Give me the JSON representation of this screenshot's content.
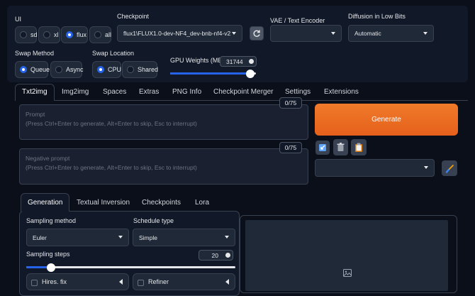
{
  "ui": {
    "label": "UI",
    "options": [
      "sd",
      "xl",
      "flux",
      "all"
    ],
    "selected": "flux"
  },
  "checkpoint": {
    "label": "Checkpoint",
    "value": "flux1\\FLUX1.0-dev-NF4_dev-bnb-nf4-v2.sa"
  },
  "vae": {
    "label": "VAE / Text Encoder",
    "value": ""
  },
  "diffusion": {
    "label": "Diffusion in Low Bits",
    "value": "Automatic"
  },
  "swap_method": {
    "label": "Swap Method",
    "options": [
      "Queue",
      "Async"
    ],
    "selected": "Queue"
  },
  "swap_location": {
    "label": "Swap Location",
    "options": [
      "CPU",
      "Shared"
    ],
    "selected": "CPU"
  },
  "gpu_weights": {
    "label": "GPU Weights (MB)",
    "value": "31744",
    "fraction": 0.93
  },
  "tabs": [
    "Txt2img",
    "Img2img",
    "Spaces",
    "Extras",
    "PNG Info",
    "Checkpoint Merger",
    "Settings",
    "Extensions"
  ],
  "active_tab": "Txt2img",
  "prompt": {
    "label": "Prompt",
    "placeholder": "(Press Ctrl+Enter to generate, Alt+Enter to skip, Esc to interrupt)",
    "counter": "0/75"
  },
  "negative_prompt": {
    "label": "Negative prompt",
    "placeholder": "(Press Ctrl+Enter to generate, Alt+Enter to skip, Esc to interrupt)",
    "counter": "0/75"
  },
  "generate_label": "Generate",
  "styles_select_value": "",
  "subtabs": [
    "Generation",
    "Textual Inversion",
    "Checkpoints",
    "Lora"
  ],
  "active_subtab": "Generation",
  "sampling_method": {
    "label": "Sampling method",
    "value": "Euler"
  },
  "schedule_type": {
    "label": "Schedule type",
    "value": "Simple"
  },
  "sampling_steps": {
    "label": "Sampling steps",
    "value": "20",
    "fraction": 0.12
  },
  "hires_fix": {
    "label": "Hires. fix"
  },
  "refiner": {
    "label": "Refiner"
  },
  "colors": {
    "accent": "#2563eb",
    "generate": "#ea6a1e",
    "background": "#0b0f19"
  }
}
